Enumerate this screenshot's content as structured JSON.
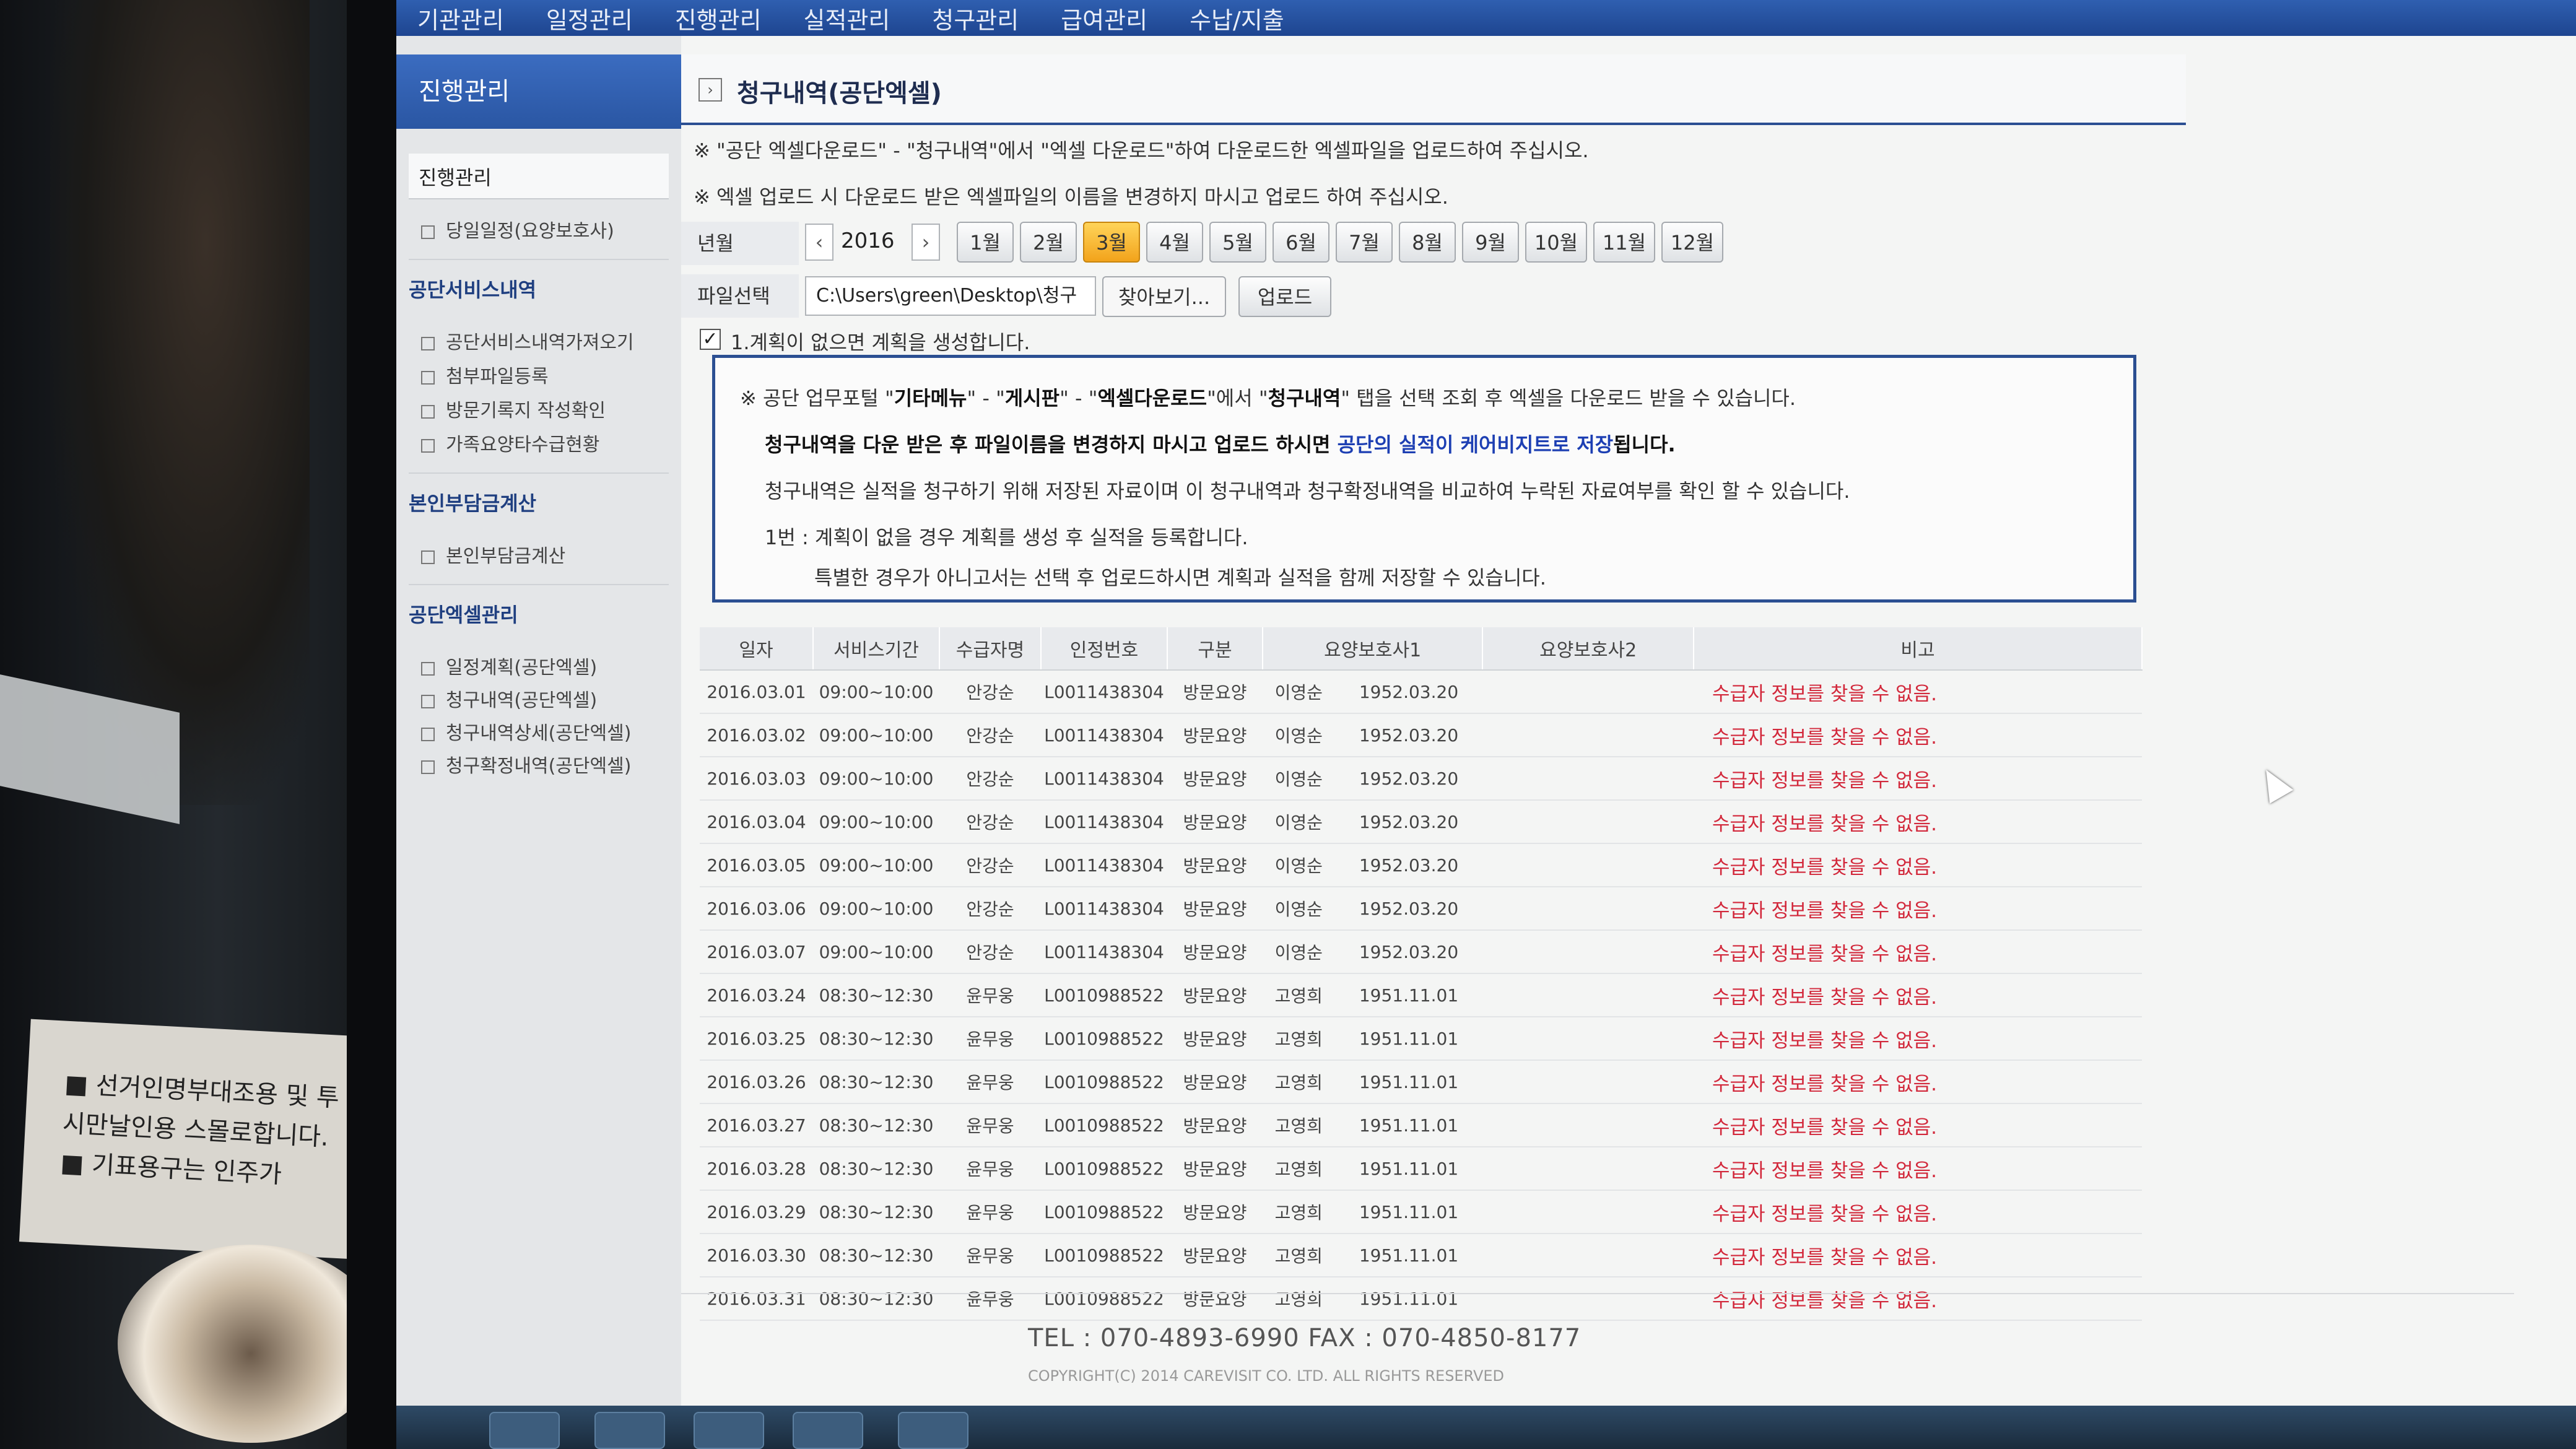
{
  "topnav": [
    "기관관리",
    "일정관리",
    "진행관리",
    "실적관리",
    "청구관리",
    "급여관리",
    "수납/지출"
  ],
  "sidebar": {
    "header": "진행관리",
    "active_item": "진행관리",
    "item_today": "당일일정(요양보호사)",
    "section1": "공단서비스내역",
    "section1_items": [
      "공단서비스내역가져오기",
      "첨부파일등록",
      "방문기록지 작성확인",
      "가족요양타수급현황"
    ],
    "section2": "본인부담금계산",
    "section2_items": [
      "본인부담금계산"
    ],
    "section3": "공단엑셀관리",
    "section3_items": [
      "일정계획(공단엑셀)",
      "청구내역(공단엑셀)",
      "청구내역상세(공단엑셀)",
      "청구확정내역(공단엑셀)"
    ]
  },
  "page": {
    "title": "청구내역(공단엑셀)",
    "note1": "※ \"공단 엑셀다운로드\" - \"청구내역\"에서 \"엑셀 다운로드\"하여 다운로드한 엑셀파일을 업로드하여 주십시오.",
    "note2": "※ 엑셀 업로드 시 다운로드 받은 엑셀파일의 이름을 변경하지 마시고 업로드 하여 주십시오."
  },
  "year_month": {
    "label": "년월",
    "prev_icon": "‹",
    "year": "2016",
    "next_icon": "›",
    "months": [
      "1월",
      "2월",
      "3월",
      "4월",
      "5월",
      "6월",
      "7월",
      "8월",
      "9월",
      "10월",
      "11월",
      "12월"
    ],
    "selected": "3월"
  },
  "file": {
    "label": "파일선택",
    "path": "C:\\Users\\green\\Desktop\\청구",
    "browse_label": "찾아보기...",
    "upload_label": "업로드"
  },
  "option": {
    "checked": true,
    "check_mark": "✓",
    "label": "1.계획이 없으면 계획을 생성합니다."
  },
  "info": {
    "line1_a": "※ 공단 업무포털 \"",
    "line1_b": "기타메뉴",
    "line1_c": "\" - \"",
    "line1_d": "게시판",
    "line1_e": "\" - \"",
    "line1_f": "엑셀다운로드",
    "line1_g": "\"에서 \"",
    "line1_h": "청구내역",
    "line1_i": "\" 탭을 선택 조회 후 엑셀을 다운로드 받을 수 있습니다.",
    "line2_a": "청구내역을 다운 받은 후 파일이름을 변경하지 마시고 업로드 하시면 ",
    "line2_b": "공단의 실적이 케어비지트로 저장",
    "line2_c": "됩니다.",
    "line3": "청구내역은 실적을 청구하기 위해 저장된 자료이며 이 청구내역과 청구확정내역을 비교하여 누락된 자료여부를 확인 할 수 있습니다.",
    "line4": "1번 : 계획이 없을 경우 계획를 생성 후 실적을 등록합니다.",
    "line5": "특별한 경우가 아니고서는 선택 후 업로드하시면 계획과 실적을 함께 저장할 수 있습니다."
  },
  "table": {
    "headers": [
      "일자",
      "서비스기간",
      "수급자명",
      "인정번호",
      "구분",
      "요양보호사1",
      "요양보호사2",
      "비고"
    ],
    "rows": [
      [
        "2016.03.01",
        "09:00~10:00",
        "안강순",
        "L0011438304",
        "방문요양",
        "이영순",
        "1952.03.20",
        "",
        "",
        "수급자 정보를 찾을 수 없음."
      ],
      [
        "2016.03.02",
        "09:00~10:00",
        "안강순",
        "L0011438304",
        "방문요양",
        "이영순",
        "1952.03.20",
        "",
        "",
        "수급자 정보를 찾을 수 없음."
      ],
      [
        "2016.03.03",
        "09:00~10:00",
        "안강순",
        "L0011438304",
        "방문요양",
        "이영순",
        "1952.03.20",
        "",
        "",
        "수급자 정보를 찾을 수 없음."
      ],
      [
        "2016.03.04",
        "09:00~10:00",
        "안강순",
        "L0011438304",
        "방문요양",
        "이영순",
        "1952.03.20",
        "",
        "",
        "수급자 정보를 찾을 수 없음."
      ],
      [
        "2016.03.05",
        "09:00~10:00",
        "안강순",
        "L0011438304",
        "방문요양",
        "이영순",
        "1952.03.20",
        "",
        "",
        "수급자 정보를 찾을 수 없음."
      ],
      [
        "2016.03.06",
        "09:00~10:00",
        "안강순",
        "L0011438304",
        "방문요양",
        "이영순",
        "1952.03.20",
        "",
        "",
        "수급자 정보를 찾을 수 없음."
      ],
      [
        "2016.03.07",
        "09:00~10:00",
        "안강순",
        "L0011438304",
        "방문요양",
        "이영순",
        "1952.03.20",
        "",
        "",
        "수급자 정보를 찾을 수 없음."
      ],
      [
        "2016.03.24",
        "08:30~12:30",
        "윤무웅",
        "L0010988522",
        "방문요양",
        "고영희",
        "1951.11.01",
        "",
        "",
        "수급자 정보를 찾을 수 없음."
      ],
      [
        "2016.03.25",
        "08:30~12:30",
        "윤무웅",
        "L0010988522",
        "방문요양",
        "고영희",
        "1951.11.01",
        "",
        "",
        "수급자 정보를 찾을 수 없음."
      ],
      [
        "2016.03.26",
        "08:30~12:30",
        "윤무웅",
        "L0010988522",
        "방문요양",
        "고영희",
        "1951.11.01",
        "",
        "",
        "수급자 정보를 찾을 수 없음."
      ],
      [
        "2016.03.27",
        "08:30~12:30",
        "윤무웅",
        "L0010988522",
        "방문요양",
        "고영희",
        "1951.11.01",
        "",
        "",
        "수급자 정보를 찾을 수 없음."
      ],
      [
        "2016.03.28",
        "08:30~12:30",
        "윤무웅",
        "L0010988522",
        "방문요양",
        "고영희",
        "1951.11.01",
        "",
        "",
        "수급자 정보를 찾을 수 없음."
      ],
      [
        "2016.03.29",
        "08:30~12:30",
        "윤무웅",
        "L0010988522",
        "방문요양",
        "고영희",
        "1951.11.01",
        "",
        "",
        "수급자 정보를 찾을 수 없음."
      ],
      [
        "2016.03.30",
        "08:30~12:30",
        "윤무웅",
        "L0010988522",
        "방문요양",
        "고영희",
        "1951.11.01",
        "",
        "",
        "수급자 정보를 찾을 수 없음."
      ],
      [
        "2016.03.31",
        "08:30~12:30",
        "윤무웅",
        "L0010988522",
        "방문요양",
        "고영희",
        "1951.11.01",
        "",
        "",
        "수급자 정보를 찾을 수 없음."
      ]
    ]
  },
  "footer": {
    "tel": "TEL : 070-4893-6990   FAX : 070-4850-8177",
    "copyright": "COPYRIGHT(C) 2014 CAREVISIT CO. LTD. ALL RIGHTS RESERVED"
  },
  "photo_card": [
    "■ 선거인명부대조용 및 투",
    "시만날인용 스몰로합니다.",
    "■ 기표용구는 인주가"
  ],
  "colors": {
    "nav_blue": "#2f5fb0",
    "selected_month": "#f2a31b",
    "remark_red": "#d2283b",
    "info_border": "#2b4f92"
  }
}
